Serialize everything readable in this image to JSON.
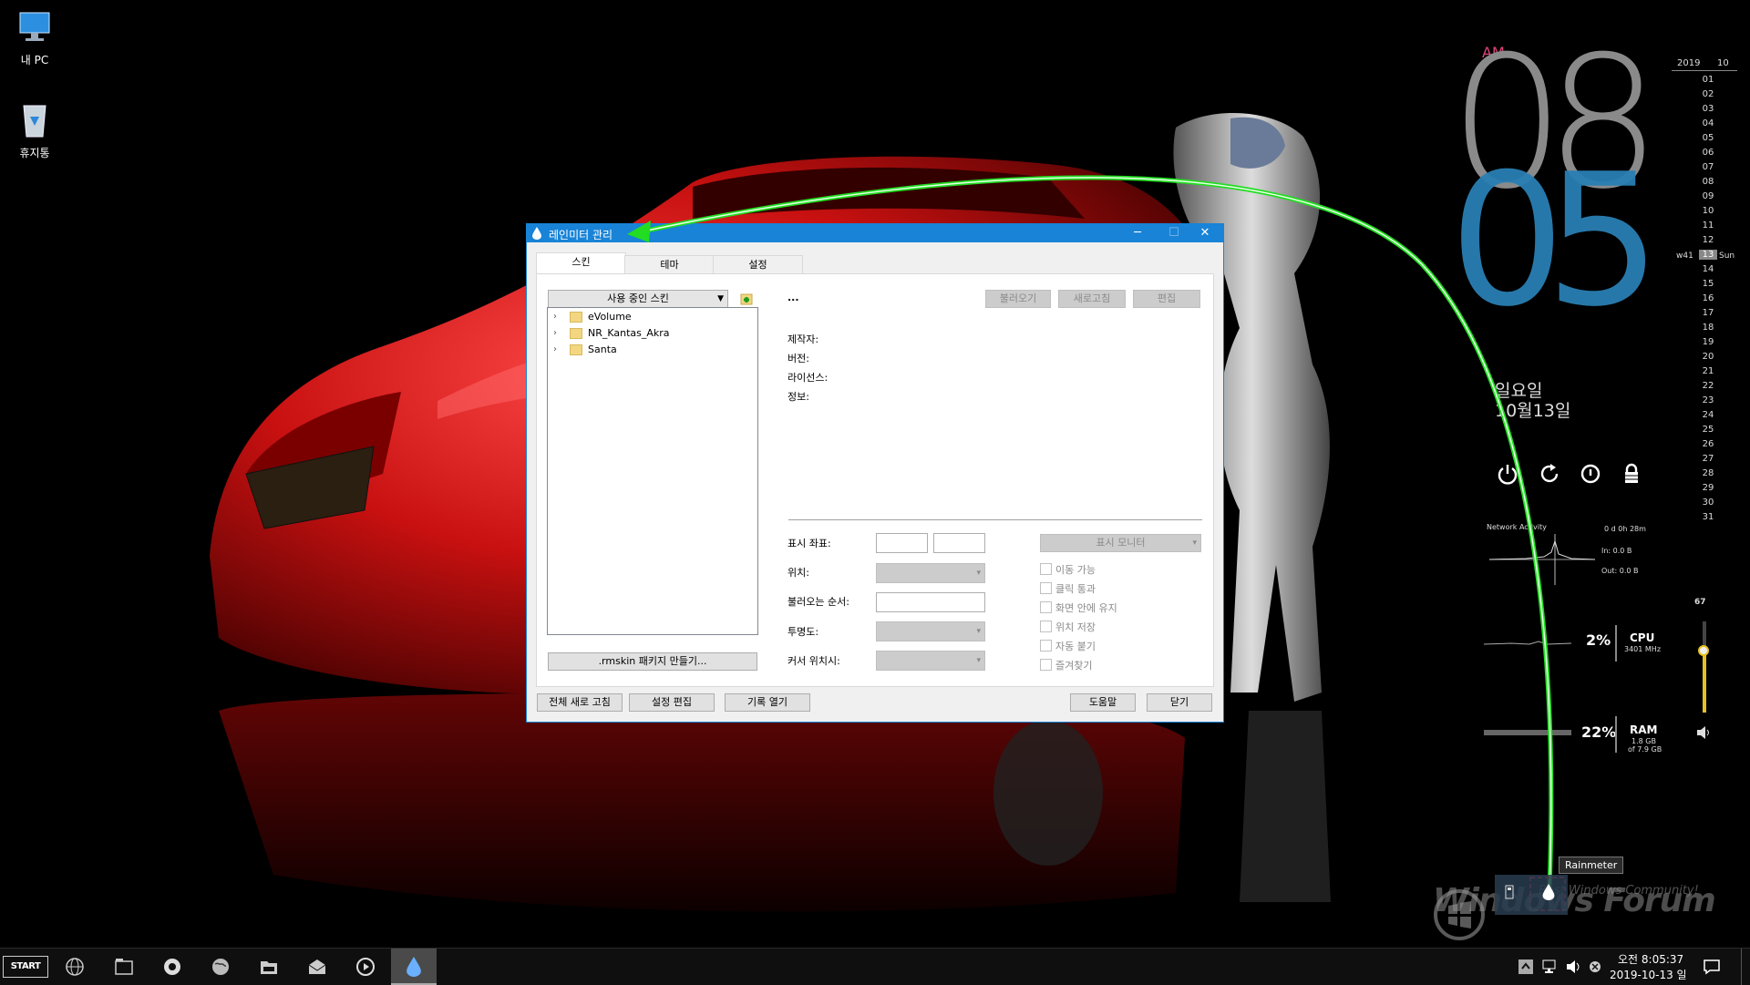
{
  "desktop": {
    "icons": [
      {
        "label": "내 PC",
        "icon": "monitor-icon"
      },
      {
        "label": "휴지통",
        "icon": "recycle-bin-icon"
      }
    ]
  },
  "dialog": {
    "title": "레인미터 관리",
    "tabs": [
      "스킨",
      "테마",
      "설정"
    ],
    "active_tab": "스킨",
    "skins_combo": "사용 중인 스킨",
    "skins": [
      "eVolume",
      "NR_Kantas_Akra",
      "Santa"
    ],
    "selected_name": "...",
    "top_buttons": {
      "load": "불러오기",
      "refresh": "새로고침",
      "edit": "편집"
    },
    "info_labels": {
      "author": "제작자:",
      "version": "버전:",
      "license": "라이선스:",
      "info": "정보:"
    },
    "settings_labels": {
      "coords": "표시 좌표:",
      "position": "위치:",
      "load_order": "불러오는 순서:",
      "transparency": "투명도:",
      "on_hover": "커서 위치시:"
    },
    "monitor_combo": "표시 모니터",
    "checkboxes": [
      "이동 가능",
      "클릭 통과",
      "화면 안에 유지",
      "위치 저장",
      "자동 붙기",
      "즐겨찾기"
    ],
    "package_button": ".rmskin 패키지 만들기...",
    "bottom_buttons": {
      "refresh_all": "전체 새로 고침",
      "edit_settings": "설정 편집",
      "open_log": "기록 열기",
      "help": "도움말",
      "close": "닫기"
    }
  },
  "clock": {
    "ampm": "AM",
    "hour": "08",
    "minute": "05",
    "day": "일요일",
    "date": "10월13일"
  },
  "calendar": {
    "year": "2019",
    "month": "10",
    "week": "w41",
    "today": "13",
    "weekday": "Sun",
    "days": [
      "01",
      "02",
      "03",
      "04",
      "05",
      "06",
      "07",
      "08",
      "09",
      "10",
      "11",
      "12",
      "13",
      "14",
      "15",
      "16",
      "17",
      "18",
      "19",
      "20",
      "21",
      "22",
      "23",
      "24",
      "25",
      "26",
      "27",
      "28",
      "29",
      "30",
      "31"
    ]
  },
  "network": {
    "label": "Network Activity",
    "uptime": "0 d 0h 28m",
    "in": "In: 0.0 B",
    "out": "Out: 0.0 B"
  },
  "cpu": {
    "pct": "2%",
    "label": "CPU",
    "sub": "3401 MHz"
  },
  "ram": {
    "pct": "22%",
    "label": "RAM",
    "sub1": "1.8 GB",
    "sub2": "of 7.9 GB"
  },
  "volume": {
    "value": "67",
    "level": 0.67
  },
  "tooltip": "Rainmeter",
  "watermark": {
    "main": "Windows Forum",
    "sub": "Best Windows Community!"
  },
  "taskbar": {
    "start": "START",
    "time": "오전 8:05:37",
    "date": "2019-10-13 일"
  }
}
